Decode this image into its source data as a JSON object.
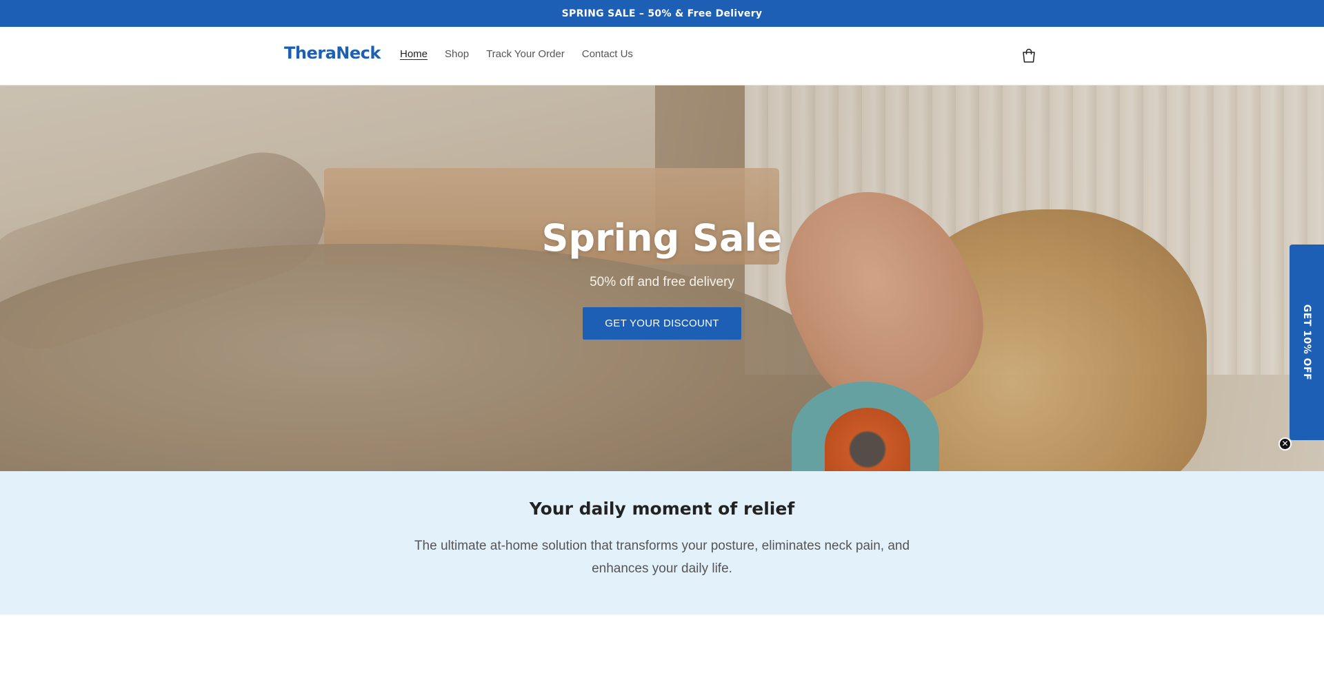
{
  "announcement": {
    "text": "SPRING SALE – 50% & Free Delivery"
  },
  "header": {
    "logo": "TheraNeck",
    "nav": [
      {
        "label": "Home",
        "active": true
      },
      {
        "label": "Shop",
        "active": false
      },
      {
        "label": "Track Your Order",
        "active": false
      },
      {
        "label": "Contact Us",
        "active": false
      }
    ],
    "cart_icon": "shopping-bag-icon"
  },
  "hero": {
    "title": "Spring Sale",
    "subtitle": "50% off and free delivery",
    "cta_label": "GET YOUR DISCOUNT"
  },
  "side_promo": {
    "label": "GET 10% OFF",
    "close_icon": "close-icon"
  },
  "relief": {
    "heading": "Your daily moment of relief",
    "body": "The ultimate at-home solution that transforms your posture, eliminates neck pain, and enhances your daily life."
  },
  "colors": {
    "brand_blue": "#1d5fb5",
    "section_bg": "#e3f1fb"
  }
}
